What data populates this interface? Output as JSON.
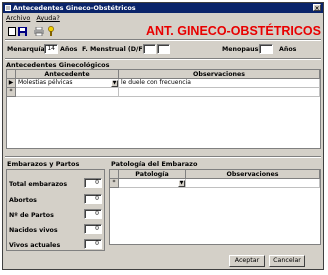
{
  "window": {
    "title": "Antecedentes Gineco-Obstétricos",
    "close_glyph": "×"
  },
  "menu": {
    "items": [
      "Archivo",
      "Ayuda?"
    ]
  },
  "toolbar": {
    "icons": [
      "new-doc-icon",
      "save-icon",
      "print-icon",
      "help-icon"
    ]
  },
  "app_heading": "ANT. GINECO-OBSTÉTRICOS",
  "header_fields": {
    "menarquia_label": "Menarquía",
    "menarquia_value": "14",
    "anios_label_1": "Años",
    "f_menstrual_label": "F. Menstrual (D/F)",
    "f_menstrual_d": "",
    "f_menstrual_f": "",
    "menopausia_label": "Menopausia",
    "menopausia_value": "",
    "anios_label_2": "Años"
  },
  "antecedentes": {
    "title": "Antecedentes Ginecológicos",
    "columns": [
      "Antecedente",
      "Observaciones"
    ],
    "rows": [
      {
        "marker": "▶",
        "antecedente": "Molestias pélvicas",
        "observaciones": "le duele con frecuencia"
      },
      {
        "marker": "*",
        "antecedente": "",
        "observaciones": ""
      }
    ]
  },
  "embarazos": {
    "title": "Embarazos y Partos",
    "fields": [
      {
        "label": "Total embarazos",
        "value": "0"
      },
      {
        "label": "Abortos",
        "value": "0"
      },
      {
        "label": "Nº de Partos",
        "value": "0"
      },
      {
        "label": "Nacidos vivos",
        "value": "0"
      },
      {
        "label": "Vivos actuales",
        "value": "0"
      }
    ]
  },
  "patologia": {
    "title": "Patología del Embarazo",
    "columns": [
      "Patología",
      "Observaciones"
    ],
    "rows": [
      {
        "marker": "*",
        "patologia": "",
        "observaciones": ""
      }
    ]
  },
  "buttons": {
    "accept": "Aceptar",
    "cancel": "Cancelar"
  }
}
